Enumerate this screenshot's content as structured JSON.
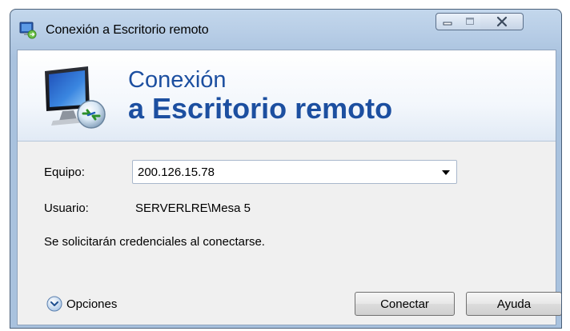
{
  "window": {
    "title": "Conexión a Escritorio remoto"
  },
  "banner": {
    "line1": "Conexión",
    "line2": "a Escritorio remoto"
  },
  "form": {
    "computer_label": "Equipo:",
    "computer_value": "200.126.15.78",
    "user_label": "Usuario:",
    "user_value": "SERVERLRE\\Mesa 5",
    "credentials_note": "Se solicitarán credenciales al conectarse."
  },
  "footer": {
    "options_label": "Opciones",
    "connect_label": "Conectar",
    "help_label": "Ayuda"
  },
  "icons": {
    "app": "remote-desktop-icon",
    "banner": "monitor-remote-icon",
    "dropdown": "chevron-down-icon",
    "options": "expand-circle-icon",
    "minimize": "minimize-icon",
    "maximize": "maximize-icon",
    "close": "close-icon"
  },
  "colors": {
    "banner_text": "#1c4fa0",
    "titlebar": "#b7cde6",
    "client_bg": "#f0f0f0"
  }
}
